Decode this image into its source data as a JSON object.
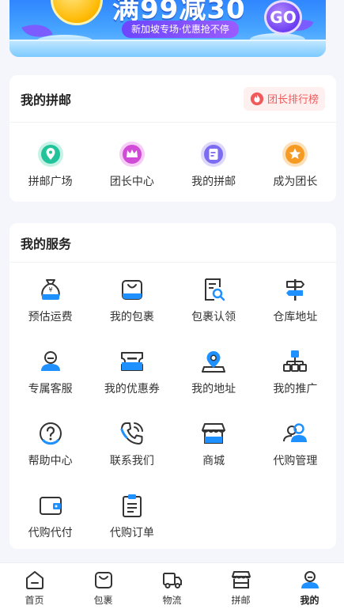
{
  "banner": {
    "title": "满99减30",
    "subtitle": "新加坡专场·优惠抢不停",
    "badge": "GO"
  },
  "pinyou": {
    "title": "我的拼邮",
    "rank_button": "团长排行榜",
    "items": [
      {
        "label": "拼邮广场",
        "icon": "location-pin-icon",
        "color": "#22c39b"
      },
      {
        "label": "团长中心",
        "icon": "crown-icon",
        "color": "#d04bd6"
      },
      {
        "label": "我的拼邮",
        "icon": "document-icon",
        "color": "#7c6cf2"
      },
      {
        "label": "成为团长",
        "icon": "star-icon",
        "color": "#f59a23"
      }
    ]
  },
  "services": {
    "title": "我的服务",
    "items": [
      {
        "label": "预估运费",
        "icon": "money-bag-icon"
      },
      {
        "label": "我的包裹",
        "icon": "bag-icon"
      },
      {
        "label": "包裹认领",
        "icon": "claim-document-icon"
      },
      {
        "label": "仓库地址",
        "icon": "signpost-icon"
      },
      {
        "label": "专属客服",
        "icon": "service-agent-icon"
      },
      {
        "label": "我的优惠券",
        "icon": "coupon-icon"
      },
      {
        "label": "我的地址",
        "icon": "address-pin-icon"
      },
      {
        "label": "我的推广",
        "icon": "hierarchy-icon"
      },
      {
        "label": "帮助中心",
        "icon": "help-icon"
      },
      {
        "label": "联系我们",
        "icon": "phone-icon"
      },
      {
        "label": "商城",
        "icon": "store-icon"
      },
      {
        "label": "代购管理",
        "icon": "users-icon"
      },
      {
        "label": "代购代付",
        "icon": "wallet-icon"
      },
      {
        "label": "代购订单",
        "icon": "order-clipboard-icon"
      }
    ]
  },
  "nav": {
    "items": [
      {
        "label": "首页",
        "icon": "home-icon"
      },
      {
        "label": "包裹",
        "icon": "package-icon"
      },
      {
        "label": "物流",
        "icon": "truck-icon"
      },
      {
        "label": "拼邮",
        "icon": "shop-icon"
      },
      {
        "label": "我的",
        "icon": "profile-icon"
      }
    ],
    "active_index": 4
  },
  "colors": {
    "accent_blue": "#1e90ff",
    "dark_stroke": "#333333",
    "rank_red": "#f05a5a"
  }
}
